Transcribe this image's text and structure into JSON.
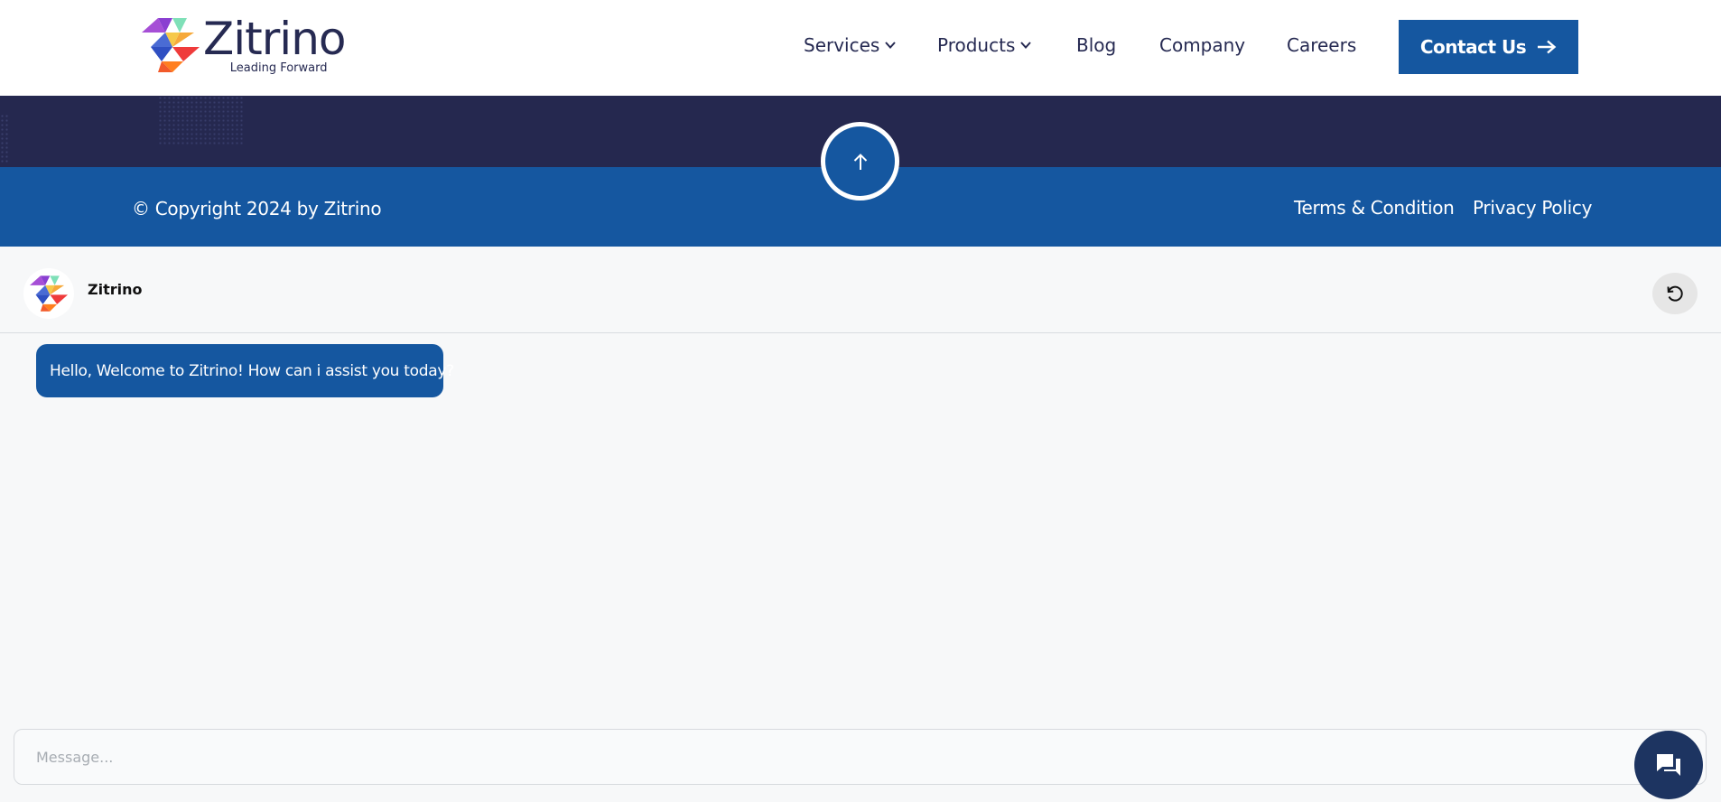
{
  "header": {
    "brand_name": "Zitrino",
    "brand_tagline": "Leading Forward",
    "nav": [
      {
        "label": "Services",
        "dropdown": true
      },
      {
        "label": "Products",
        "dropdown": true
      },
      {
        "label": "Blog",
        "dropdown": false
      },
      {
        "label": "Company",
        "dropdown": false
      },
      {
        "label": "Careers",
        "dropdown": false
      }
    ],
    "contact_label": "Contact Us"
  },
  "footer": {
    "copyright": "© Copyright 2024 by Zitrino",
    "links": [
      "Terms & Condition",
      "Privacy Policy"
    ]
  },
  "chat": {
    "bot_name": "Zitrino",
    "welcome_message": "Hello, Welcome to Zitrino! How can i assist you today?",
    "input_placeholder": "Message..."
  },
  "icons": {
    "nav_dropdown": "chevron-down-icon",
    "contact": "arrow-right-icon",
    "scroll_top": "arrow-up-icon",
    "chat_reset": "refresh-icon",
    "chat_toggle": "chat-bubbles-icon"
  },
  "colors": {
    "primary_blue": "#1557a0",
    "navy": "#25284f",
    "text_dark": "#262a52",
    "fab_navy": "#1d3461"
  }
}
